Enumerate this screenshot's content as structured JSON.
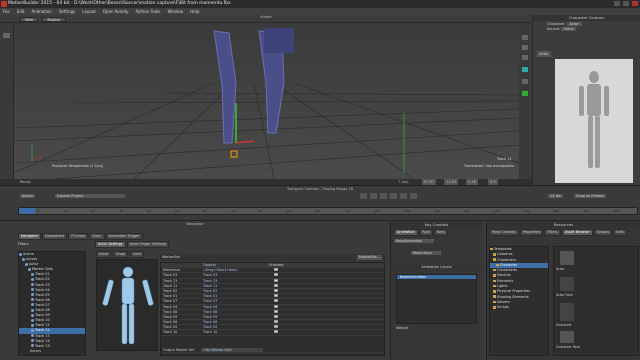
{
  "title": "MotionBuilder 2015 - 64 bit - D:\\Work\\Other\\Boson\\Soccer\\motion capture\\F\\Bit from mannerdo.fbx",
  "menu": [
    "File",
    "Edit",
    "Animation",
    "Settings",
    "Layout",
    "Open Reality",
    "Python Tools",
    "Window",
    "Help"
  ],
  "viewer": {
    "title": "Viewer",
    "tabs": [
      "View",
      "Display"
    ],
    "camera_label": "Producer Perspective (1:1(e))",
    "track_label": "Track 12",
    "manip_label": "Translation: Use manipulator",
    "status_left": "Ready",
    "status_right": [
      "7 (ba)",
      "57.67",
      "11.03",
      "5.46",
      "0.5"
    ]
  },
  "character_controls": {
    "title": "Character Controls",
    "character_label": "Character:",
    "character_value": "Actor",
    "source_label": "Source:",
    "source_value": "None",
    "tab": "Actor"
  },
  "transport": {
    "title": "Transport Controls - Playing Range 78",
    "mode": "Action",
    "take": "Explore Project",
    "fps": "24 fps",
    "snap": "Snap on Frames",
    "ticks": [
      "0",
      "10",
      "20",
      "30",
      "40",
      "50",
      "60",
      "70",
      "80",
      "90",
      "100",
      "110",
      "120",
      "130",
      "140",
      "150",
      "160",
      "170",
      "180",
      "190",
      "200"
    ]
  },
  "navigator": {
    "title": "Navigator",
    "tabs": [
      "Navigator",
      "Dopesheet",
      "FCurves",
      "Story",
      "Animation Trigger"
    ],
    "subtabs": [
      "Actor Settings",
      "Actor Finger Settings"
    ],
    "filters_label": "Filters",
    "tree": [
      "Scene",
      "Actors",
      "Actor",
      "Marker Sets",
      "Track 01",
      "Track 02",
      "Track 03",
      "Track 04",
      "Track 05",
      "Track 06",
      "Track 07",
      "Track 08",
      "Track 09",
      "Track 10",
      "Track 11",
      "Track 12",
      "Track 13",
      "Track 14",
      "Track 15"
    ],
    "selected_index": 15,
    "graph_tabs": [
      "Actor",
      "Snap",
      "Lock"
    ],
    "marker_set_label": "MarkerSet",
    "marker_set_button": "MarkerSet...",
    "columns": [
      "Reference",
      "Objects",
      "Oriented"
    ],
    "rows": [
      [
        "Reference",
        "<Drop Object Here>"
      ],
      [
        "Track 03",
        "Track 03"
      ],
      [
        "Track 13",
        "Track 13"
      ],
      [
        "Track 11",
        "Track 11"
      ],
      [
        "Track 02",
        "Track 02"
      ],
      [
        "Track 01",
        "Track 01"
      ],
      [
        "Track 07",
        "Track 07"
      ],
      [
        "Track 04",
        "Track 04"
      ],
      [
        "Track 08",
        "Track 08"
      ],
      [
        "Track 09",
        "Track 09"
      ],
      [
        "Track 06",
        "Track 06"
      ],
      [
        "Track 05",
        "Track 05"
      ],
      [
        "Track 10",
        "Track 10"
      ]
    ],
    "output_label": "Output Marker Set",
    "output_value": "<No Marker Set>",
    "bottom_label": "Actors"
  },
  "key_controls": {
    "title": "Key Controls",
    "tabs": [
      "Animation",
      "Type",
      "Keys"
    ],
    "layer": "BaseAnimation",
    "filter_label": "Move Keys",
    "anim_layers_title": "Animation Layers",
    "layer_item": "BaseAnimation",
    "weight_label": "Weight"
  },
  "resources": {
    "title": "Resources",
    "tabs": [
      "Pose Controls",
      "Properties",
      "Filters",
      "Asset Browser",
      "Groups",
      "Sets"
    ],
    "tree": [
      "Templates",
      "Cameras",
      "Characters",
      "Character",
      "Constraints",
      "Devices",
      "Elements",
      "Lights",
      "Physical Properties",
      "Shading Elements",
      "Solvers",
      "Scripts"
    ],
    "selected_index": 3,
    "thumbs": [
      "Actor",
      "Actor Face",
      "Character",
      "Character Face"
    ]
  },
  "colors": {
    "select": "#3d6ea5",
    "accent": "#c0392b"
  }
}
